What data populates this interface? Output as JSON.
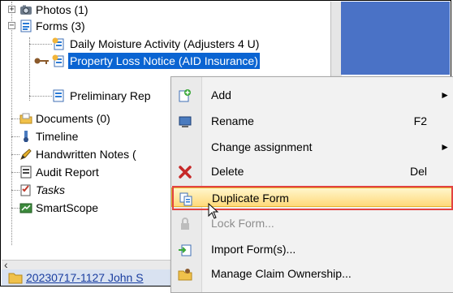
{
  "tree": {
    "items": [
      {
        "label": "Photos (1)",
        "icon": "camera-folder-icon"
      },
      {
        "label": "Forms (3)",
        "icon": "form-icon"
      },
      {
        "label": "Daily Moisture Activity (Adjusters 4 U)",
        "icon": "form-doc-icon"
      },
      {
        "label": "Property Loss Notice (AID Insurance)",
        "icon": "form-doc-icon"
      },
      {
        "label": "Preliminary Rep",
        "icon": "form-doc-icon"
      },
      {
        "label": "Documents (0)",
        "icon": "documents-folder-icon"
      },
      {
        "label": "Timeline",
        "icon": "timeline-icon"
      },
      {
        "label": "Handwritten Notes (",
        "icon": "pencil-icon"
      },
      {
        "label": "Audit Report",
        "icon": "audit-report-icon"
      },
      {
        "label": "Tasks",
        "icon": "tasks-icon"
      },
      {
        "label": "SmartScope",
        "icon": "smartscope-icon"
      }
    ]
  },
  "bottom": {
    "claim_label": "20230717-1127 John S"
  },
  "menu": {
    "items": [
      {
        "label": "Add",
        "shortcut": "",
        "submenu": "►",
        "icon": "add-icon"
      },
      {
        "label": "Rename",
        "shortcut": "F2",
        "submenu": "",
        "icon": "rename-icon"
      },
      {
        "label": "Change assignment",
        "shortcut": "",
        "submenu": "►",
        "icon": ""
      },
      {
        "label": "Delete",
        "shortcut": "Del",
        "submenu": "",
        "icon": "delete-x-icon"
      },
      {
        "label": "Duplicate Form",
        "shortcut": "",
        "submenu": "",
        "icon": "duplicate-icon"
      },
      {
        "label": "Lock Form...",
        "shortcut": "",
        "submenu": "",
        "icon": "lock-icon"
      },
      {
        "label": "Import Form(s)...",
        "shortcut": "",
        "submenu": "",
        "icon": "import-icon"
      },
      {
        "label": "Manage Claim Ownership...",
        "shortcut": "",
        "submenu": "",
        "icon": "claim-ownership-icon"
      }
    ]
  },
  "colors": {
    "selection": "#0a64d2",
    "highlight_border": "#e24343",
    "delete_red": "#c62828"
  }
}
